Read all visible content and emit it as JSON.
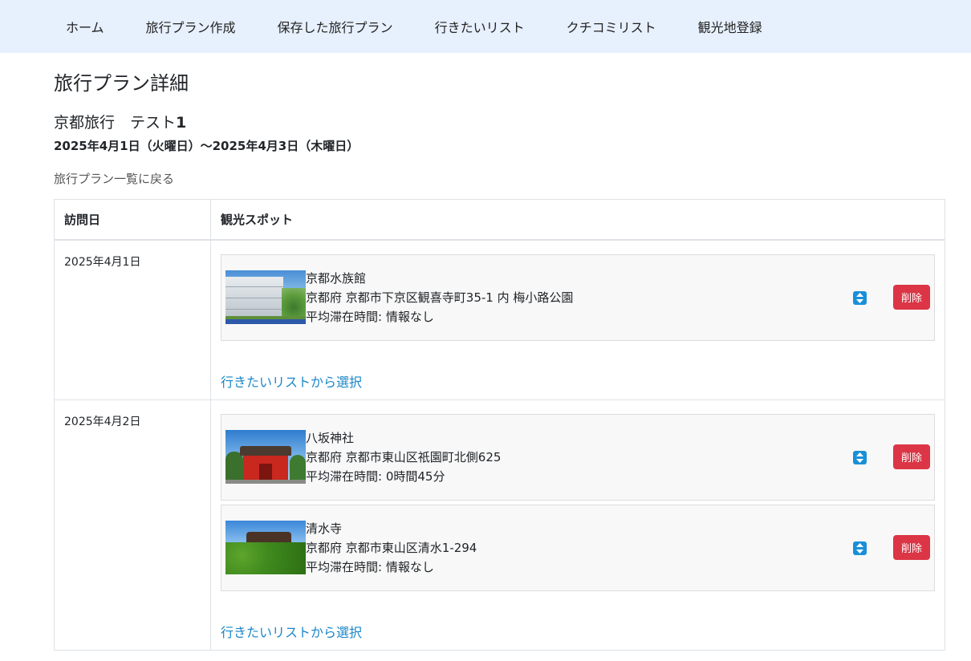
{
  "nav": {
    "items": [
      {
        "label": "ホーム"
      },
      {
        "label": "旅行プラン作成"
      },
      {
        "label": "保存した旅行プラン"
      },
      {
        "label": "行きたいリスト"
      },
      {
        "label": "クチコミリスト"
      },
      {
        "label": "観光地登録"
      }
    ]
  },
  "page": {
    "title": "旅行プラン詳細",
    "plan_name": "京都旅行　テスト",
    "plan_name_number": "1",
    "plan_dates": "2025年4月1日（火曜日）〜2025年4月3日（木曜日）",
    "back_link": "旅行プラン一覧に戻る"
  },
  "table": {
    "headers": {
      "date": "訪問日",
      "spots": "観光スポット"
    },
    "days": [
      {
        "date": "2025年4月1日",
        "spots": [
          {
            "name": "京都水族館",
            "address": "京都府 京都市下京区観喜寺町35-1 内 梅小路公園",
            "stay": "平均滞在時間: 情報なし",
            "delete_label": "削除",
            "sort_icon": "sort-arrows-icon"
          }
        ],
        "select_link": "行きたいリストから選択"
      },
      {
        "date": "2025年4月2日",
        "spots": [
          {
            "name": "八坂神社",
            "address": "京都府 京都市東山区祇園町北側625",
            "stay": "平均滞在時間: 0時間45分",
            "delete_label": "削除",
            "sort_icon": "sort-arrows-icon"
          },
          {
            "name": "清水寺",
            "address": "京都府 京都市東山区清水1-294",
            "stay": "平均滞在時間: 情報なし",
            "delete_label": "削除",
            "sort_icon": "sort-arrows-icon"
          }
        ],
        "select_link": "行きたいリストから選択"
      }
    ]
  },
  "colors": {
    "navbar_bg": "#e7f0fd",
    "delete": "#dc3545",
    "link": "#1a86c8",
    "sort_icon": "#1a8fd8",
    "card_bg": "#f8f8f8"
  }
}
